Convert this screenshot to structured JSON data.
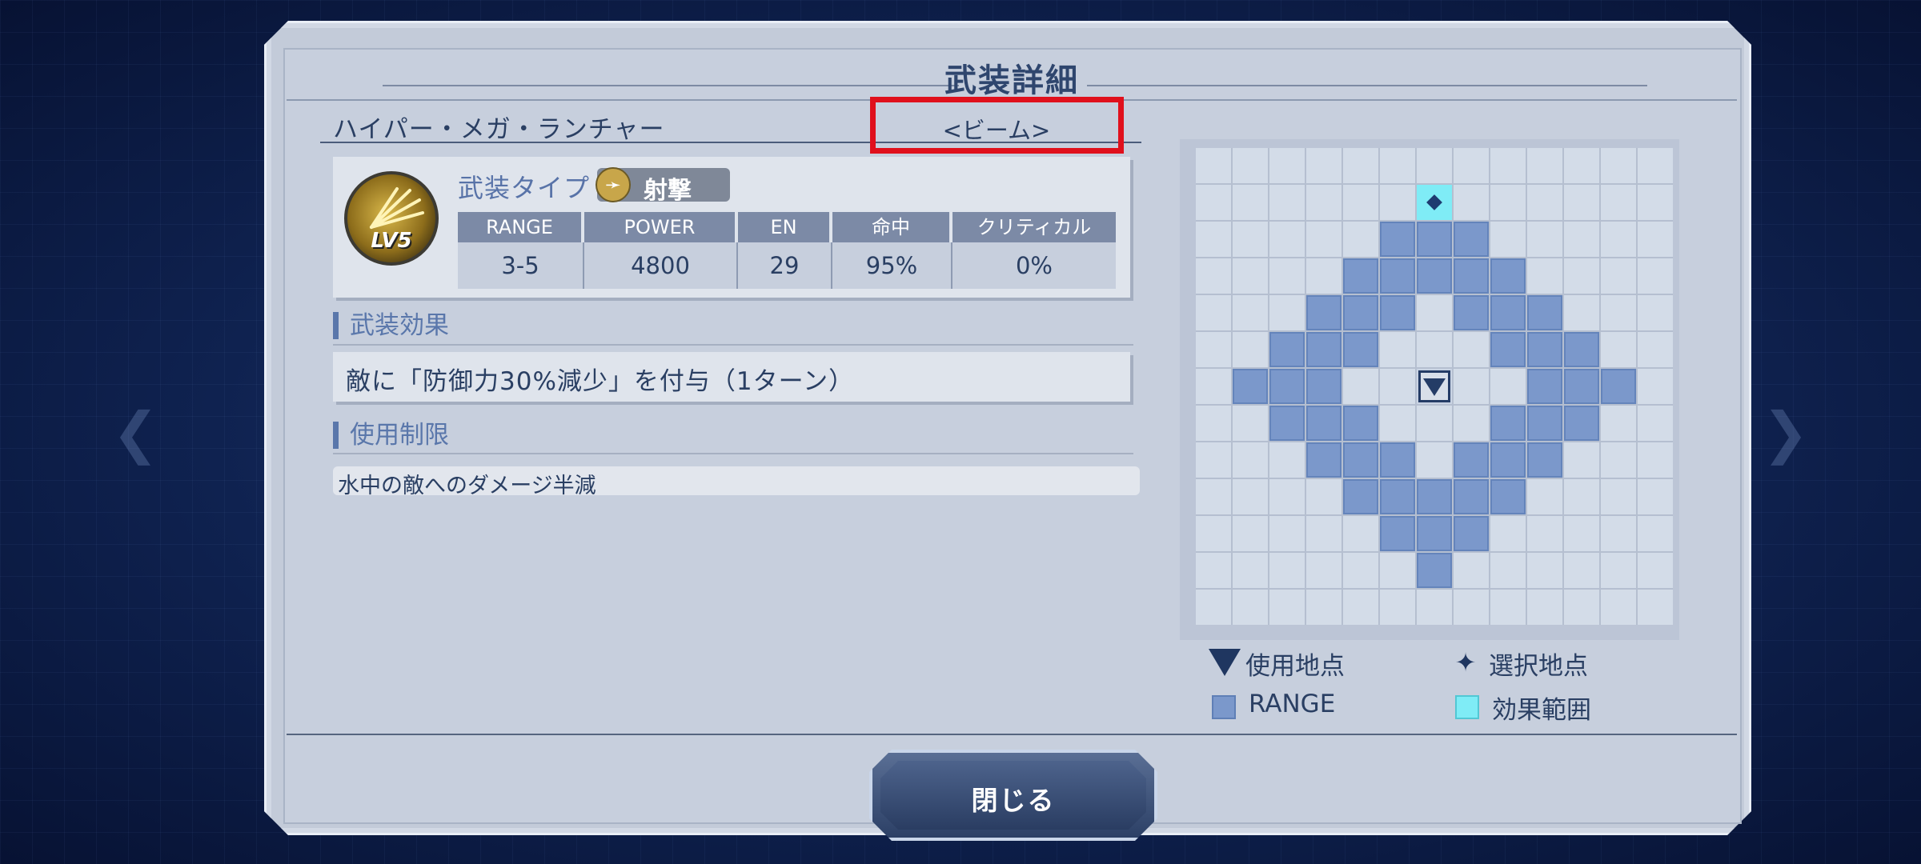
{
  "dialog": {
    "title": "武装詳細"
  },
  "weapon": {
    "name": "ハイパー・メガ・ランチャー",
    "category": "<ビーム>",
    "level": "LV5",
    "type_label": "武装タイプ",
    "type_value": "射撃"
  },
  "stats": {
    "headers": [
      "RANGE",
      "POWER",
      "EN",
      "命中",
      "クリティカル"
    ],
    "values": [
      "3-5",
      "4800",
      "29",
      "95%",
      "0%"
    ]
  },
  "effects": {
    "heading": "武装効果",
    "text": "敵に「防御力30%減少」を付与（1ターン）"
  },
  "restrictions": {
    "heading": "使用制限",
    "text": "水中の敵へのダメージ半減"
  },
  "range_grid": {
    "size": 13,
    "range_cells": [
      [
        2,
        5
      ],
      [
        2,
        6
      ],
      [
        2,
        7
      ],
      [
        3,
        4
      ],
      [
        3,
        5
      ],
      [
        3,
        6
      ],
      [
        3,
        7
      ],
      [
        3,
        8
      ],
      [
        4,
        3
      ],
      [
        4,
        4
      ],
      [
        4,
        5
      ],
      [
        4,
        7
      ],
      [
        4,
        8
      ],
      [
        4,
        9
      ],
      [
        5,
        2
      ],
      [
        5,
        3
      ],
      [
        5,
        4
      ],
      [
        5,
        8
      ],
      [
        5,
        9
      ],
      [
        5,
        10
      ],
      [
        6,
        1
      ],
      [
        6,
        2
      ],
      [
        6,
        3
      ],
      [
        6,
        9
      ],
      [
        6,
        10
      ],
      [
        6,
        11
      ],
      [
        7,
        2
      ],
      [
        7,
        3
      ],
      [
        7,
        4
      ],
      [
        7,
        8
      ],
      [
        7,
        9
      ],
      [
        7,
        10
      ],
      [
        8,
        3
      ],
      [
        8,
        4
      ],
      [
        8,
        5
      ],
      [
        8,
        7
      ],
      [
        8,
        8
      ],
      [
        8,
        9
      ],
      [
        9,
        4
      ],
      [
        9,
        5
      ],
      [
        9,
        6
      ],
      [
        9,
        7
      ],
      [
        9,
        8
      ],
      [
        10,
        5
      ],
      [
        10,
        6
      ],
      [
        10,
        7
      ],
      [
        11,
        6
      ]
    ],
    "selected_cell": [
      1,
      6
    ],
    "origin_cell": [
      6,
      6
    ]
  },
  "legend": {
    "use_point": "使用地点",
    "select_point": "選択地点",
    "range": "RANGE",
    "effect_area": "効果範囲"
  },
  "buttons": {
    "close": "閉じる"
  }
}
